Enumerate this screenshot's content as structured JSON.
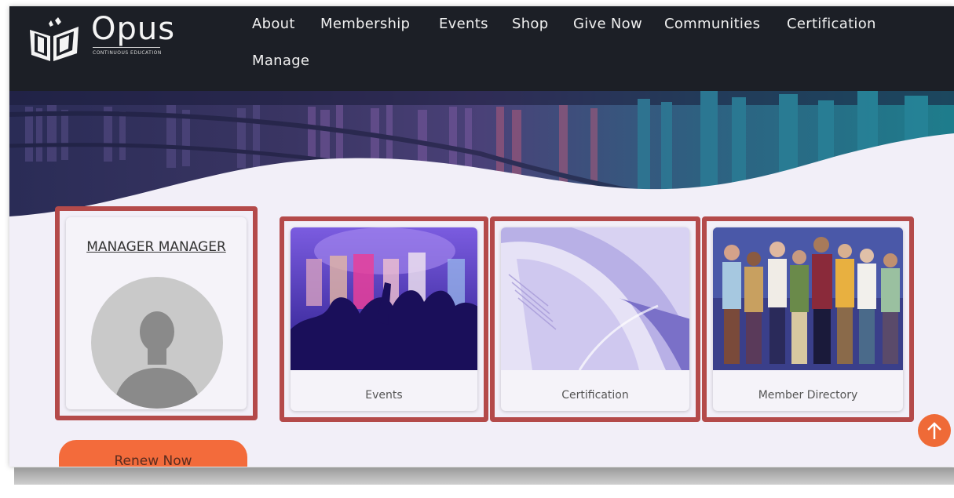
{
  "logo": {
    "name": "Opus",
    "tagline": "CONTINUOUS EDUCATION"
  },
  "nav": {
    "items": [
      "About",
      "Membership",
      "Events",
      "Shop",
      "Give Now",
      "Communities",
      "Certification",
      "Manage"
    ]
  },
  "profile": {
    "name": "MANAGER MANAGER"
  },
  "cards": [
    {
      "label": "Events"
    },
    {
      "label": "Certification"
    },
    {
      "label": "Member Directory"
    }
  ],
  "renew_button": "Renew Now",
  "colors": {
    "nav_bg": "#1c1f26",
    "highlight_border": "#b44a4a",
    "accent_orange": "#f36b3b",
    "page_bg": "#f2eff8"
  },
  "icons": {
    "scroll_top": "arrow-up-icon",
    "avatar": "user-silhouette-icon"
  }
}
